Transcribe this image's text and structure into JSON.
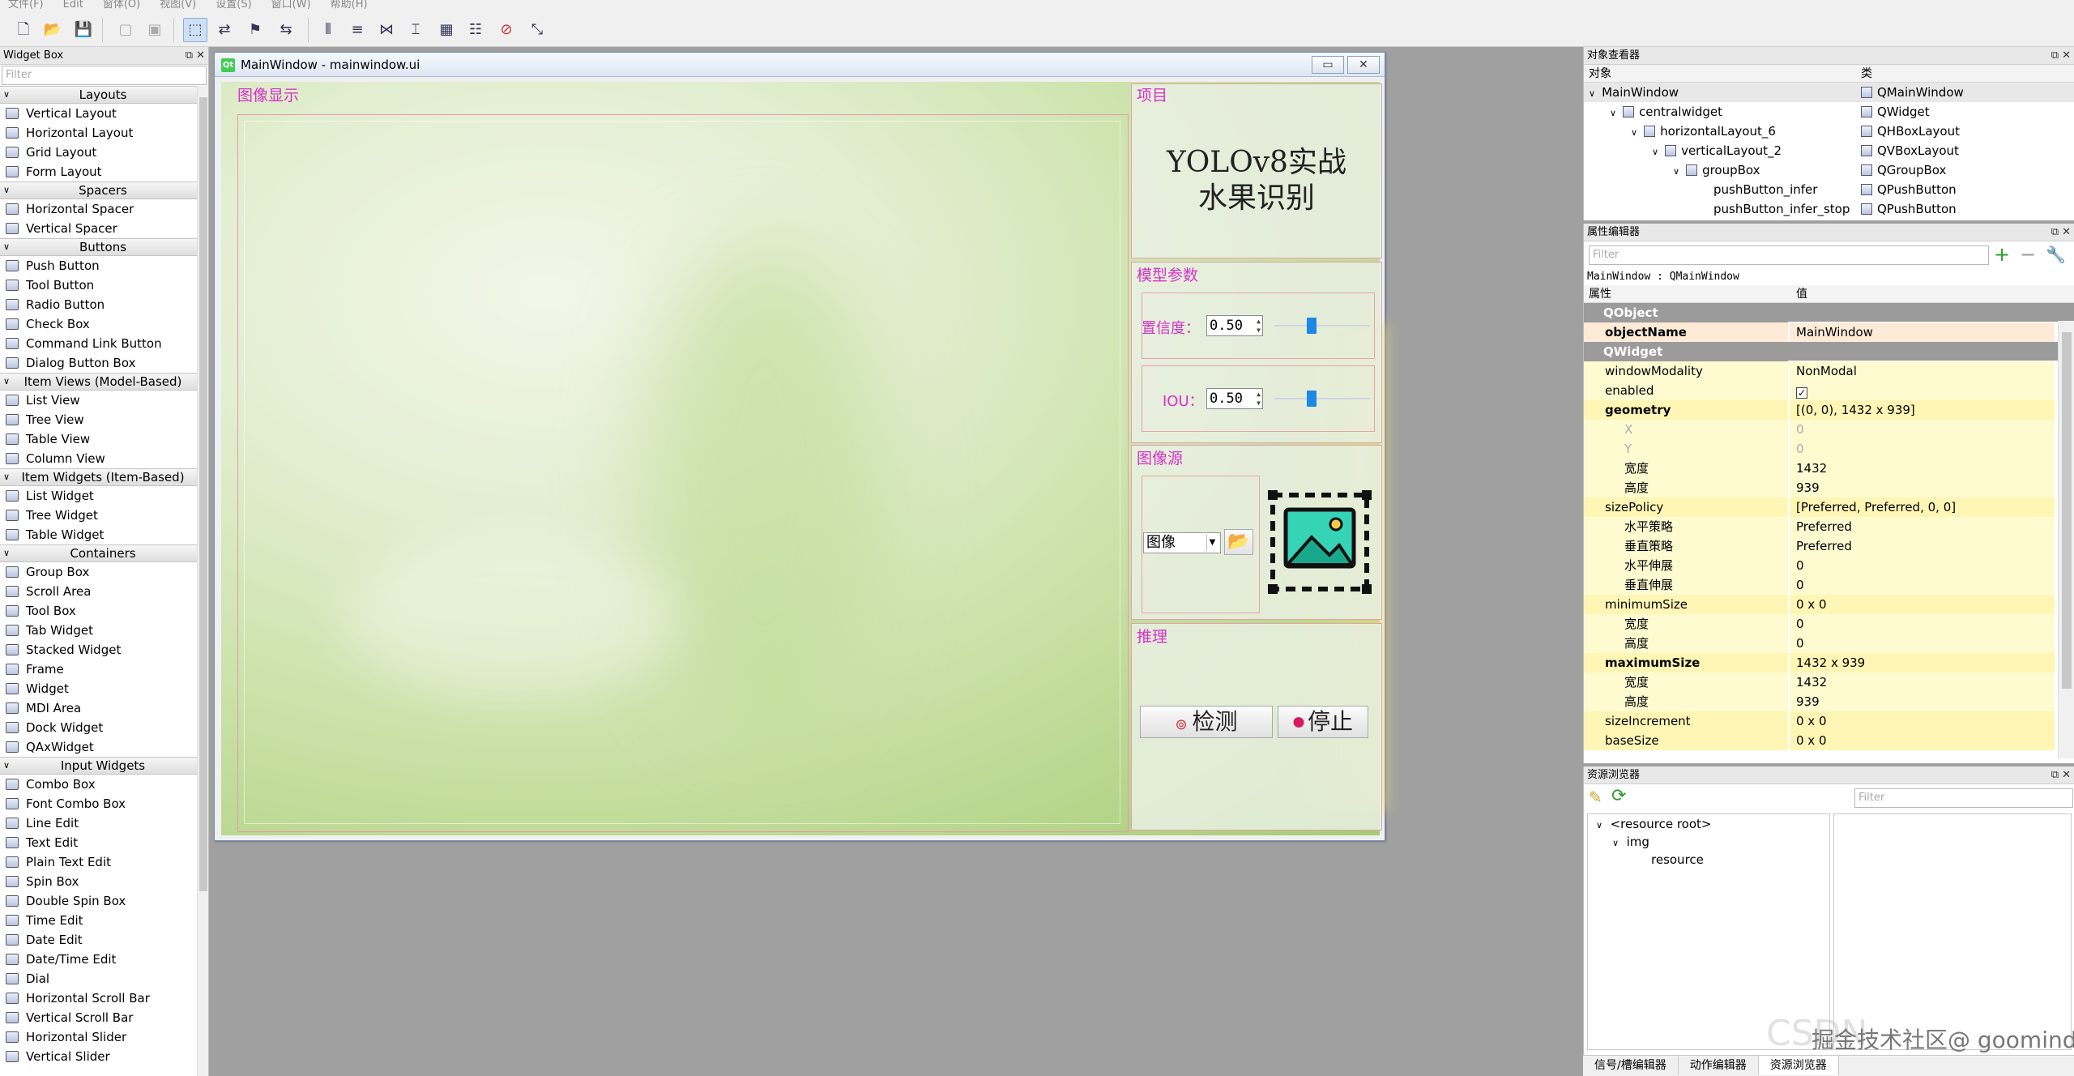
{
  "menubar": [
    "文件(F)",
    "Edit",
    "窗体(O)",
    "视图(V)",
    "设置(S)",
    "窗口(W)",
    "帮助(H)"
  ],
  "widget_box": {
    "title": "Widget Box",
    "filter_placeholder": "Filter",
    "sections": [
      {
        "name": "Layouts",
        "items": [
          "Vertical Layout",
          "Horizontal Layout",
          "Grid Layout",
          "Form Layout"
        ]
      },
      {
        "name": "Spacers",
        "items": [
          "Horizontal Spacer",
          "Vertical Spacer"
        ]
      },
      {
        "name": "Buttons",
        "items": [
          "Push Button",
          "Tool Button",
          "Radio Button",
          "Check Box",
          "Command Link Button",
          "Dialog Button Box"
        ]
      },
      {
        "name": "Item Views (Model-Based)",
        "items": [
          "List View",
          "Tree View",
          "Table View",
          "Column View"
        ]
      },
      {
        "name": "Item Widgets (Item-Based)",
        "items": [
          "List Widget",
          "Tree Widget",
          "Table Widget"
        ]
      },
      {
        "name": "Containers",
        "items": [
          "Group Box",
          "Scroll Area",
          "Tool Box",
          "Tab Widget",
          "Stacked Widget",
          "Frame",
          "Widget",
          "MDI Area",
          "Dock Widget",
          "QAxWidget"
        ]
      },
      {
        "name": "Input Widgets",
        "items": [
          "Combo Box",
          "Font Combo Box",
          "Line Edit",
          "Text Edit",
          "Plain Text Edit",
          "Spin Box",
          "Double Spin Box",
          "Time Edit",
          "Date Edit",
          "Date/Time Edit",
          "Dial",
          "Horizontal Scroll Bar",
          "Vertical Scroll Bar",
          "Horizontal Slider",
          "Vertical Slider"
        ]
      }
    ]
  },
  "form": {
    "window_title": "MainWindow - mainwindow.ui",
    "image_group_label": "图像显示",
    "project_label": "项目",
    "project_title_line1": "YOLOv8实战",
    "project_title_line2": "水果识别",
    "params_label": "模型参数",
    "confidence_label": "置信度：",
    "confidence_value": "0.50",
    "iou_label": "IOU：",
    "iou_value": "0.50",
    "source_label": "图像源",
    "source_combo": "图像",
    "infer_label": "推理",
    "detect_button": "检测",
    "stop_button": "停止"
  },
  "object_inspector": {
    "title": "对象查看器",
    "col_object": "对象",
    "col_class": "类",
    "rows": [
      {
        "name": "MainWindow",
        "cls": "QMainWindow",
        "depth": 0
      },
      {
        "name": "centralwidget",
        "cls": "QWidget",
        "depth": 1
      },
      {
        "name": "horizontalLayout_6",
        "cls": "QHBoxLayout",
        "depth": 2
      },
      {
        "name": "verticalLayout_2",
        "cls": "QVBoxLayout",
        "depth": 3
      },
      {
        "name": "groupBox",
        "cls": "QGroupBox",
        "depth": 4
      },
      {
        "name": "pushButton_infer",
        "cls": "QPushButton",
        "depth": 5
      },
      {
        "name": "pushButton_infer_stop",
        "cls": "QPushButton",
        "depth": 5
      }
    ]
  },
  "property_editor": {
    "title": "属性编辑器",
    "filter_placeholder": "Filter",
    "context": "MainWindow : QMainWindow",
    "col_property": "属性",
    "col_value": "值",
    "rows": [
      {
        "k": "QObject",
        "v": "",
        "type": "sec"
      },
      {
        "k": "objectName",
        "v": "MainWindow",
        "type": "bold"
      },
      {
        "k": "QWidget",
        "v": "",
        "type": "sec"
      },
      {
        "k": "windowModality",
        "v": "NonModal",
        "type": "y"
      },
      {
        "k": "enabled",
        "v": "☑",
        "type": "y"
      },
      {
        "k": "geometry",
        "v": "[(0, 0), 1432 x 939]",
        "type": "boldexp"
      },
      {
        "k": "X",
        "v": "0",
        "type": "subgrey"
      },
      {
        "k": "Y",
        "v": "0",
        "type": "subgrey"
      },
      {
        "k": "宽度",
        "v": "1432",
        "type": "sub"
      },
      {
        "k": "高度",
        "v": "939",
        "type": "sub"
      },
      {
        "k": "sizePolicy",
        "v": "[Preferred, Preferred, 0, 0]",
        "type": "exp"
      },
      {
        "k": "水平策略",
        "v": "Preferred",
        "type": "sub"
      },
      {
        "k": "垂直策略",
        "v": "Preferred",
        "type": "sub"
      },
      {
        "k": "水平伸展",
        "v": "0",
        "type": "sub"
      },
      {
        "k": "垂直伸展",
        "v": "0",
        "type": "sub"
      },
      {
        "k": "minimumSize",
        "v": "0 x 0",
        "type": "exp"
      },
      {
        "k": "宽度",
        "v": "0",
        "type": "sub"
      },
      {
        "k": "高度",
        "v": "0",
        "type": "sub"
      },
      {
        "k": "maximumSize",
        "v": "1432 x 939",
        "type": "boldexp"
      },
      {
        "k": "宽度",
        "v": "1432",
        "type": "sub"
      },
      {
        "k": "高度",
        "v": "939",
        "type": "sub"
      },
      {
        "k": "sizeIncrement",
        "v": "0 x 0",
        "type": "col"
      },
      {
        "k": "baseSize",
        "v": "0 x 0",
        "type": "col"
      }
    ]
  },
  "resource_browser": {
    "title": "资源浏览器",
    "filter_placeholder": "Filter",
    "tree": [
      "<resource root>",
      "img",
      "resource"
    ]
  },
  "bottom_tabs": [
    "信号/槽编辑器",
    "动作编辑器",
    "资源浏览器"
  ],
  "watermark": "CSDN",
  "watermark2": "掘金技术社区@ goomind"
}
